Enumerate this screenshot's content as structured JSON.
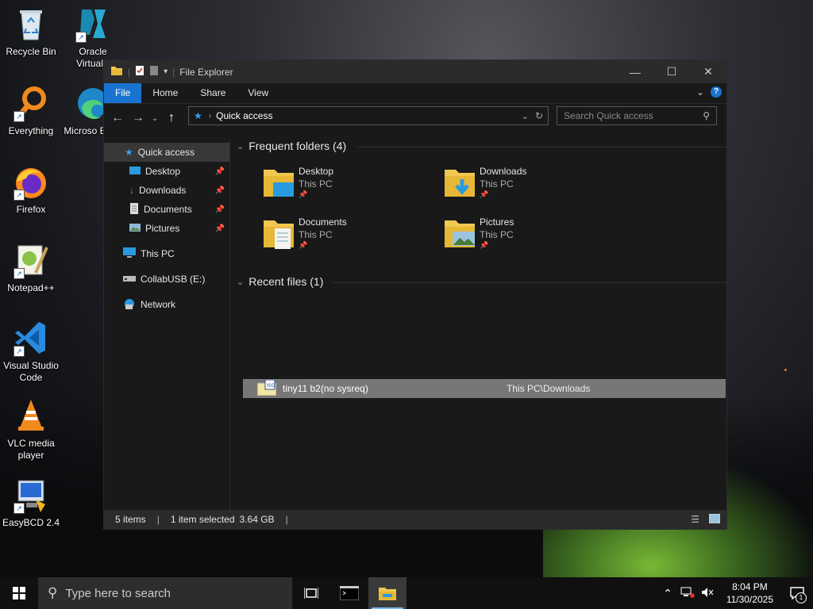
{
  "desktop": {
    "icons": [
      {
        "label": "Recycle Bin",
        "icon": "recycle-bin-icon"
      },
      {
        "label": "Everything",
        "icon": "everything-search-icon"
      },
      {
        "label": "Firefox",
        "icon": "firefox-icon"
      },
      {
        "label": "Notepad++",
        "icon": "notepad-plus-plus-icon"
      },
      {
        "label": "Visual Studio Code",
        "icon": "vscode-icon"
      },
      {
        "label": "VLC media player",
        "icon": "vlc-icon"
      },
      {
        "label": "EasyBCD 2.4",
        "icon": "easybcd-icon"
      },
      {
        "label": "Oracle VirtualB",
        "icon": "virtualbox-icon"
      },
      {
        "label": "Microso Edge",
        "icon": "edge-icon"
      }
    ]
  },
  "explorer": {
    "title": "File Explorer",
    "ribbon_tabs": [
      "File",
      "Home",
      "Share",
      "View"
    ],
    "address": "Quick access",
    "search_placeholder": "Search Quick access",
    "nav": [
      {
        "label": "Quick access",
        "selected": true
      },
      {
        "label": "Desktop",
        "pinned": true
      },
      {
        "label": "Downloads",
        "pinned": true
      },
      {
        "label": "Documents",
        "pinned": true
      },
      {
        "label": "Pictures",
        "pinned": true
      },
      {
        "label": "This PC"
      },
      {
        "label": "CollabUSB (E:)"
      },
      {
        "label": "Network"
      }
    ],
    "frequent_header": "Frequent folders (4)",
    "frequent": [
      {
        "name": "Desktop",
        "location": "This PC"
      },
      {
        "name": "Downloads",
        "location": "This PC"
      },
      {
        "name": "Documents",
        "location": "This PC"
      },
      {
        "name": "Pictures",
        "location": "This PC"
      }
    ],
    "recent_header": "Recent files (1)",
    "recent": [
      {
        "name": "tiny11 b2(no sysreq)",
        "path": "This PC\\Downloads"
      }
    ],
    "status": {
      "items": "5 items",
      "selected": "1 item selected",
      "size": "3.64 GB"
    }
  },
  "taskbar": {
    "search_placeholder": "Type here to search",
    "time": "8:04 PM",
    "date": "11/30/2025",
    "notification_count": "1"
  }
}
